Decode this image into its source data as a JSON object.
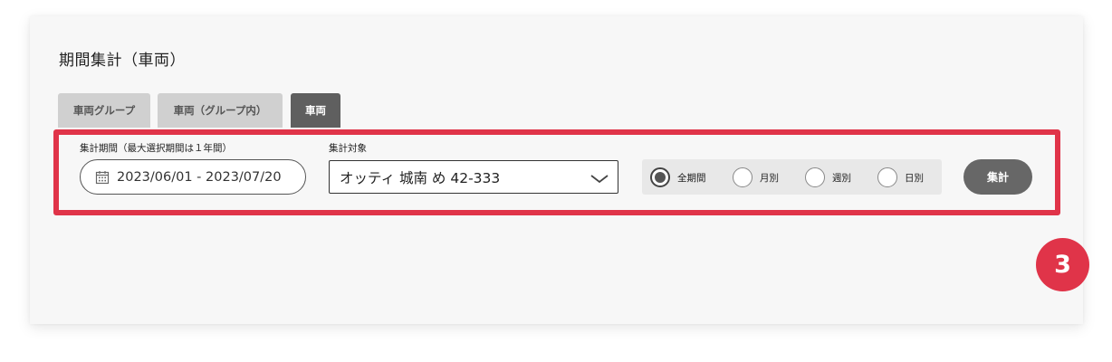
{
  "page": {
    "title": "期間集計（車両）"
  },
  "tabs": [
    {
      "label": "車両グループ",
      "active": false
    },
    {
      "label": "車両（グループ内）",
      "active": false
    },
    {
      "label": "車両",
      "active": true
    }
  ],
  "form": {
    "period_label": "集計期間（最大選択期間は１年間）",
    "period_value": "2023/06/01 - 2023/07/20",
    "target_label": "集計対象",
    "target_value": "オッティ 城南 め 42-333",
    "granularity": [
      {
        "label": "全期間",
        "checked": true
      },
      {
        "label": "月別",
        "checked": false
      },
      {
        "label": "週別",
        "checked": false
      },
      {
        "label": "日別",
        "checked": false
      }
    ],
    "submit_label": "集計"
  },
  "annotation": {
    "step": "3",
    "color": "#e03449"
  },
  "icons": {
    "date": "calendar-icon",
    "select": "chevron-down-icon"
  }
}
